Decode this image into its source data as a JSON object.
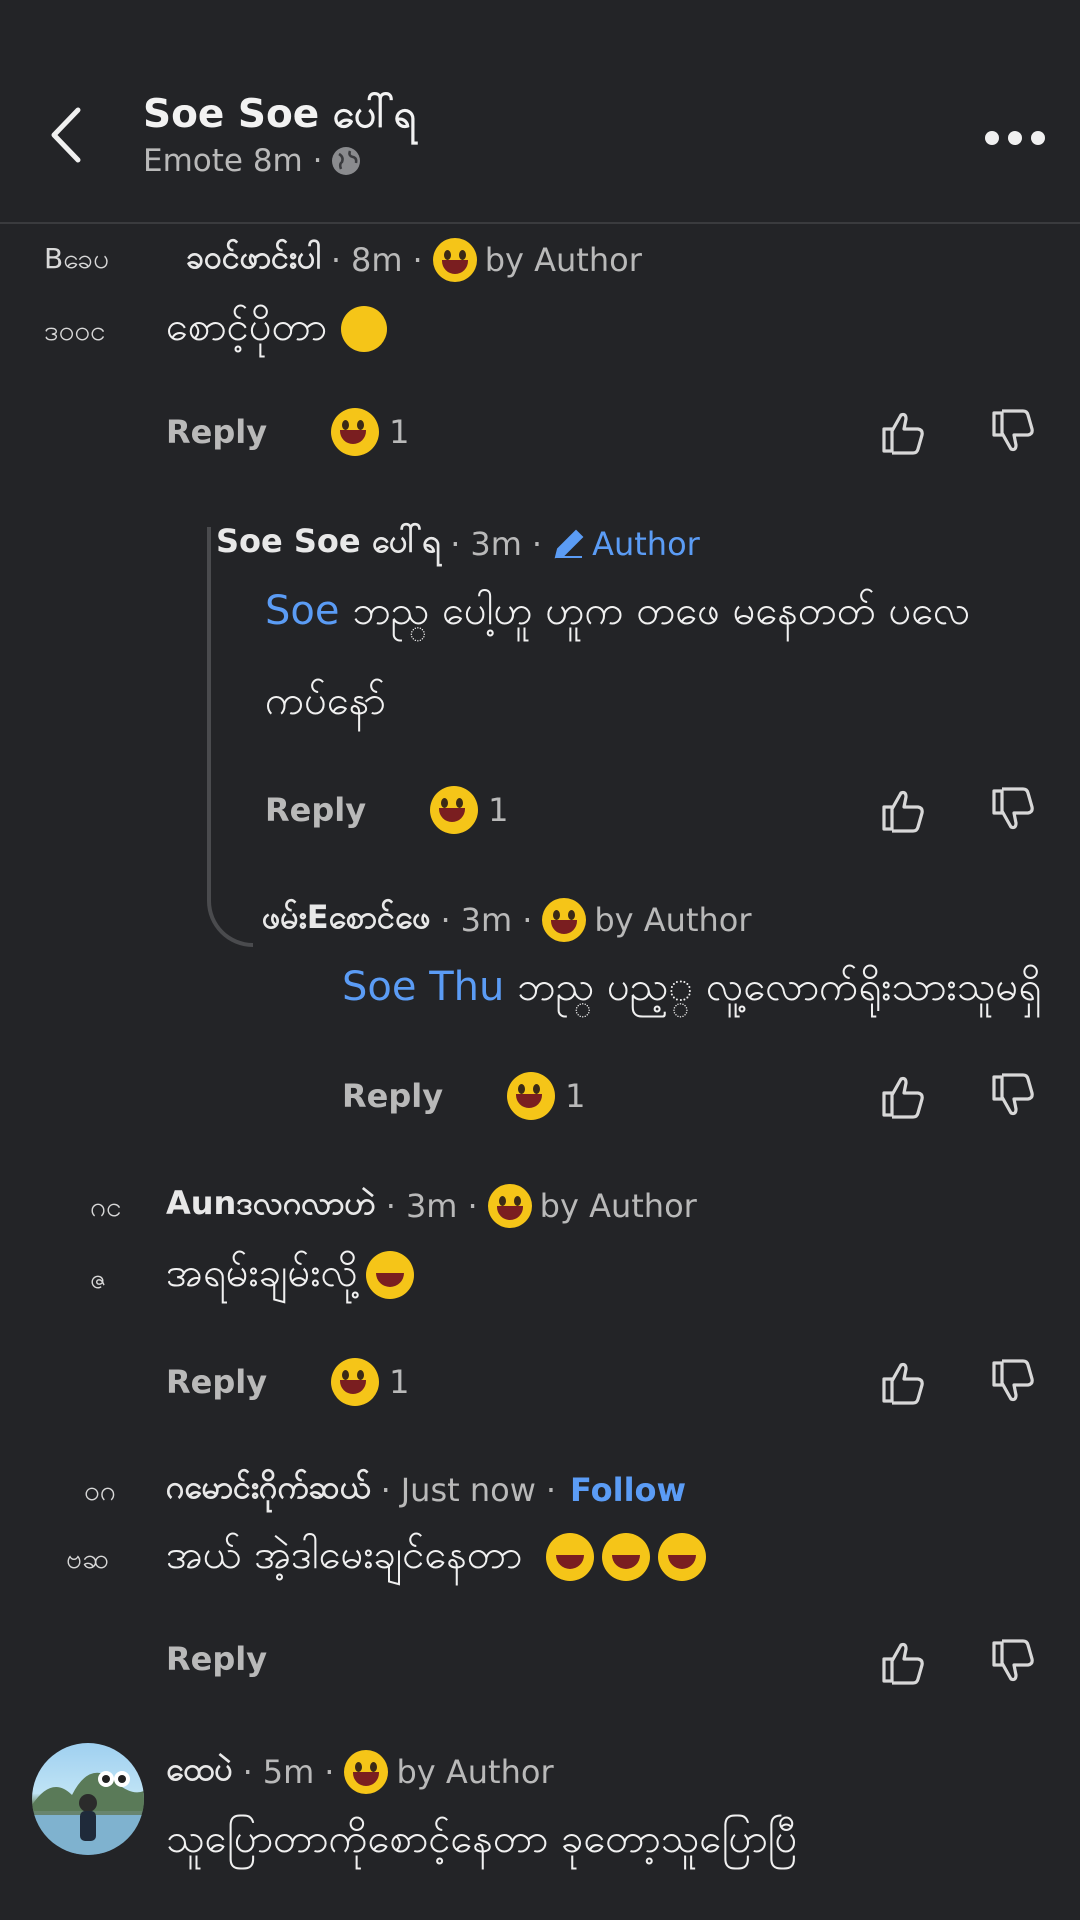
{
  "header": {
    "title": "Soe   Soe ပေါ်ရ",
    "subtitle": "Emote  8m ·",
    "more_label": "More options"
  },
  "comments": [
    {
      "avatar_text": "Bခေပ",
      "avatar_text2": "ဒဝဝင",
      "name": "ခဝင်ဖာင်းပါ",
      "time": "8m",
      "badge": "by Author",
      "text": "စောင့်ပိုတာ",
      "reply": "Reply",
      "reaction_count": "1"
    },
    {
      "name": "Soe Soe ပေါ်ရ",
      "time": "3m",
      "badge": "Author",
      "mention": "Soe",
      "text": "ဘည္ ပေါ့ဟူ ဟူက တဖေ မနေတတ် ပလေ",
      "text2": "ကပ်နော်",
      "reply": "Reply",
      "reaction_count": "1"
    },
    {
      "name": "ဖမ်းEစောင်ဖေ",
      "time": "3m",
      "badge": "by Author",
      "mention": "Soe Thu",
      "text": "ဘည္ ပည့္ လူ့လောက်ရိုးသားသူမရှိ",
      "reply": "Reply",
      "reaction_count": "1"
    },
    {
      "avatar_text": "ဂင",
      "avatar_text2": "ဇ",
      "name": "Aunဒလဂလာဟဲ",
      "time": "3m",
      "badge": "by Author",
      "text": "အရမ်းချမ်းလို့",
      "reply": "Reply",
      "reaction_count": "1"
    },
    {
      "avatar_text": "ဝဂ",
      "avatar_text2": "ဗဆ",
      "name": "ဂမောင်းဂိုက်ဆယ်",
      "time": "Just now",
      "follow": "Follow",
      "text": "အယ် အဲ့ဒါမေးချင်နေတာ",
      "reply": "Reply"
    },
    {
      "name": "ထေပဲ",
      "time": "5m",
      "badge": "by Author",
      "text": "သူပြောတာကိုစောင့်နေတာ ခုတော့သူပြောပြီ"
    }
  ],
  "icons": {
    "back": "chevron-left-icon",
    "globe": "globe-icon",
    "like": "thumbs-up-icon",
    "dislike": "thumbs-down-icon",
    "more": "more-dots-icon"
  },
  "colors": {
    "background": "#232427",
    "accent": "#5b9cf5",
    "text": "#ececec",
    "muted": "#b9b9b9"
  }
}
